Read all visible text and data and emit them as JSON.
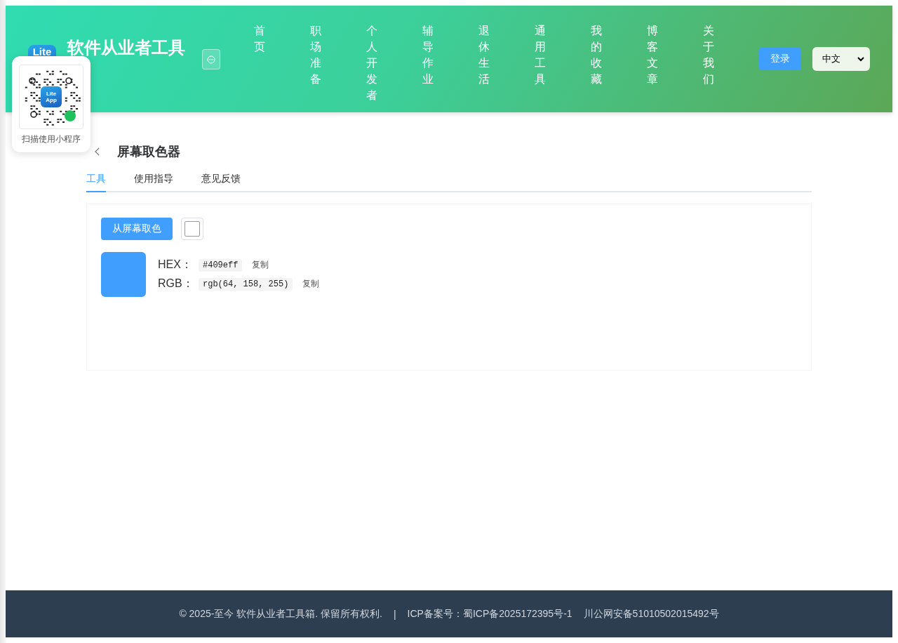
{
  "header": {
    "logo_text": "Lite",
    "title": "软件从业者工具",
    "nav": [
      {
        "label": "首页",
        "selected": false
      },
      {
        "label": "职场准备",
        "selected": false
      },
      {
        "label": "个人开发者",
        "selected": false
      },
      {
        "label": "辅导作业",
        "selected": false
      },
      {
        "label": "退休生活",
        "selected": false
      },
      {
        "label": "通用工具",
        "selected": false
      },
      {
        "label": "我的收藏",
        "selected": false
      },
      {
        "label": "博客文章",
        "selected": false
      },
      {
        "label": "关于我们",
        "selected": false
      }
    ],
    "login": "登录",
    "language": "中文"
  },
  "qr_popup": {
    "logo_lines": [
      "Lite",
      "App"
    ],
    "caption": "扫描使用小程序"
  },
  "tool": {
    "title": "屏幕取色器",
    "tabs": [
      {
        "label": "工具",
        "selected": true
      },
      {
        "label": "使用指导",
        "selected": false
      },
      {
        "label": "意见反馈",
        "selected": false
      }
    ],
    "pick_button": "从屏幕取色",
    "values": [
      {
        "label": "HEX：",
        "value": "#409eff",
        "copy": "复制"
      },
      {
        "label": "RGB：",
        "value": "rgb(64, 158, 255)",
        "copy": "复制"
      }
    ]
  },
  "footer": {
    "copyright": "© 2025-至今 软件从业者工具箱. 保留所有权利.",
    "separator": "|",
    "icp": "ICP备案号：蜀ICP备2025172395号-1",
    "police": "川公网安备51010502015492号"
  }
}
